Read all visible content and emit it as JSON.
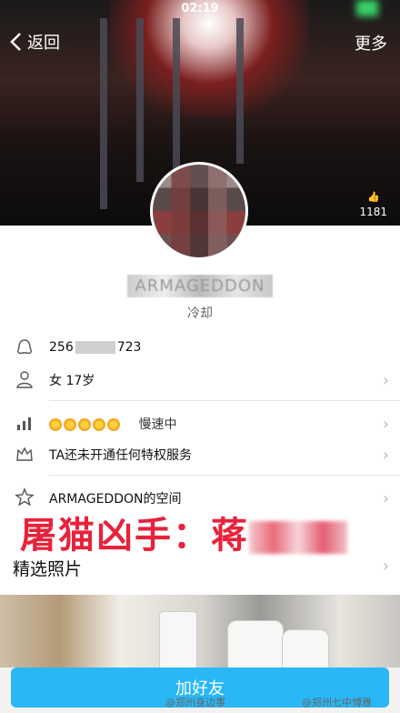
{
  "status_time": "02:19",
  "nav": {
    "back_label": "返回",
    "more_label": "更多"
  },
  "hero": {
    "like_count": "1181"
  },
  "profile": {
    "nickname": "ARMAGEDDON",
    "signature": "冷却"
  },
  "rows": {
    "qq_prefix": "256",
    "qq_suffix": "723",
    "gender_age": "女 17岁",
    "level_text": "慢速中",
    "vip_text": "TA还未开通任何特权服务",
    "space_text": "ARMAGEDDON的空间"
  },
  "overlay_caption": "屠猫凶手：蒋",
  "photos_title": "精选照片",
  "bottom_button": "加好友",
  "watermarks": {
    "left": "@郑州身边事",
    "right": "@郑州七中博雅"
  },
  "colors": {
    "accent": "#2ab7f5",
    "caption": "#e8223b"
  }
}
